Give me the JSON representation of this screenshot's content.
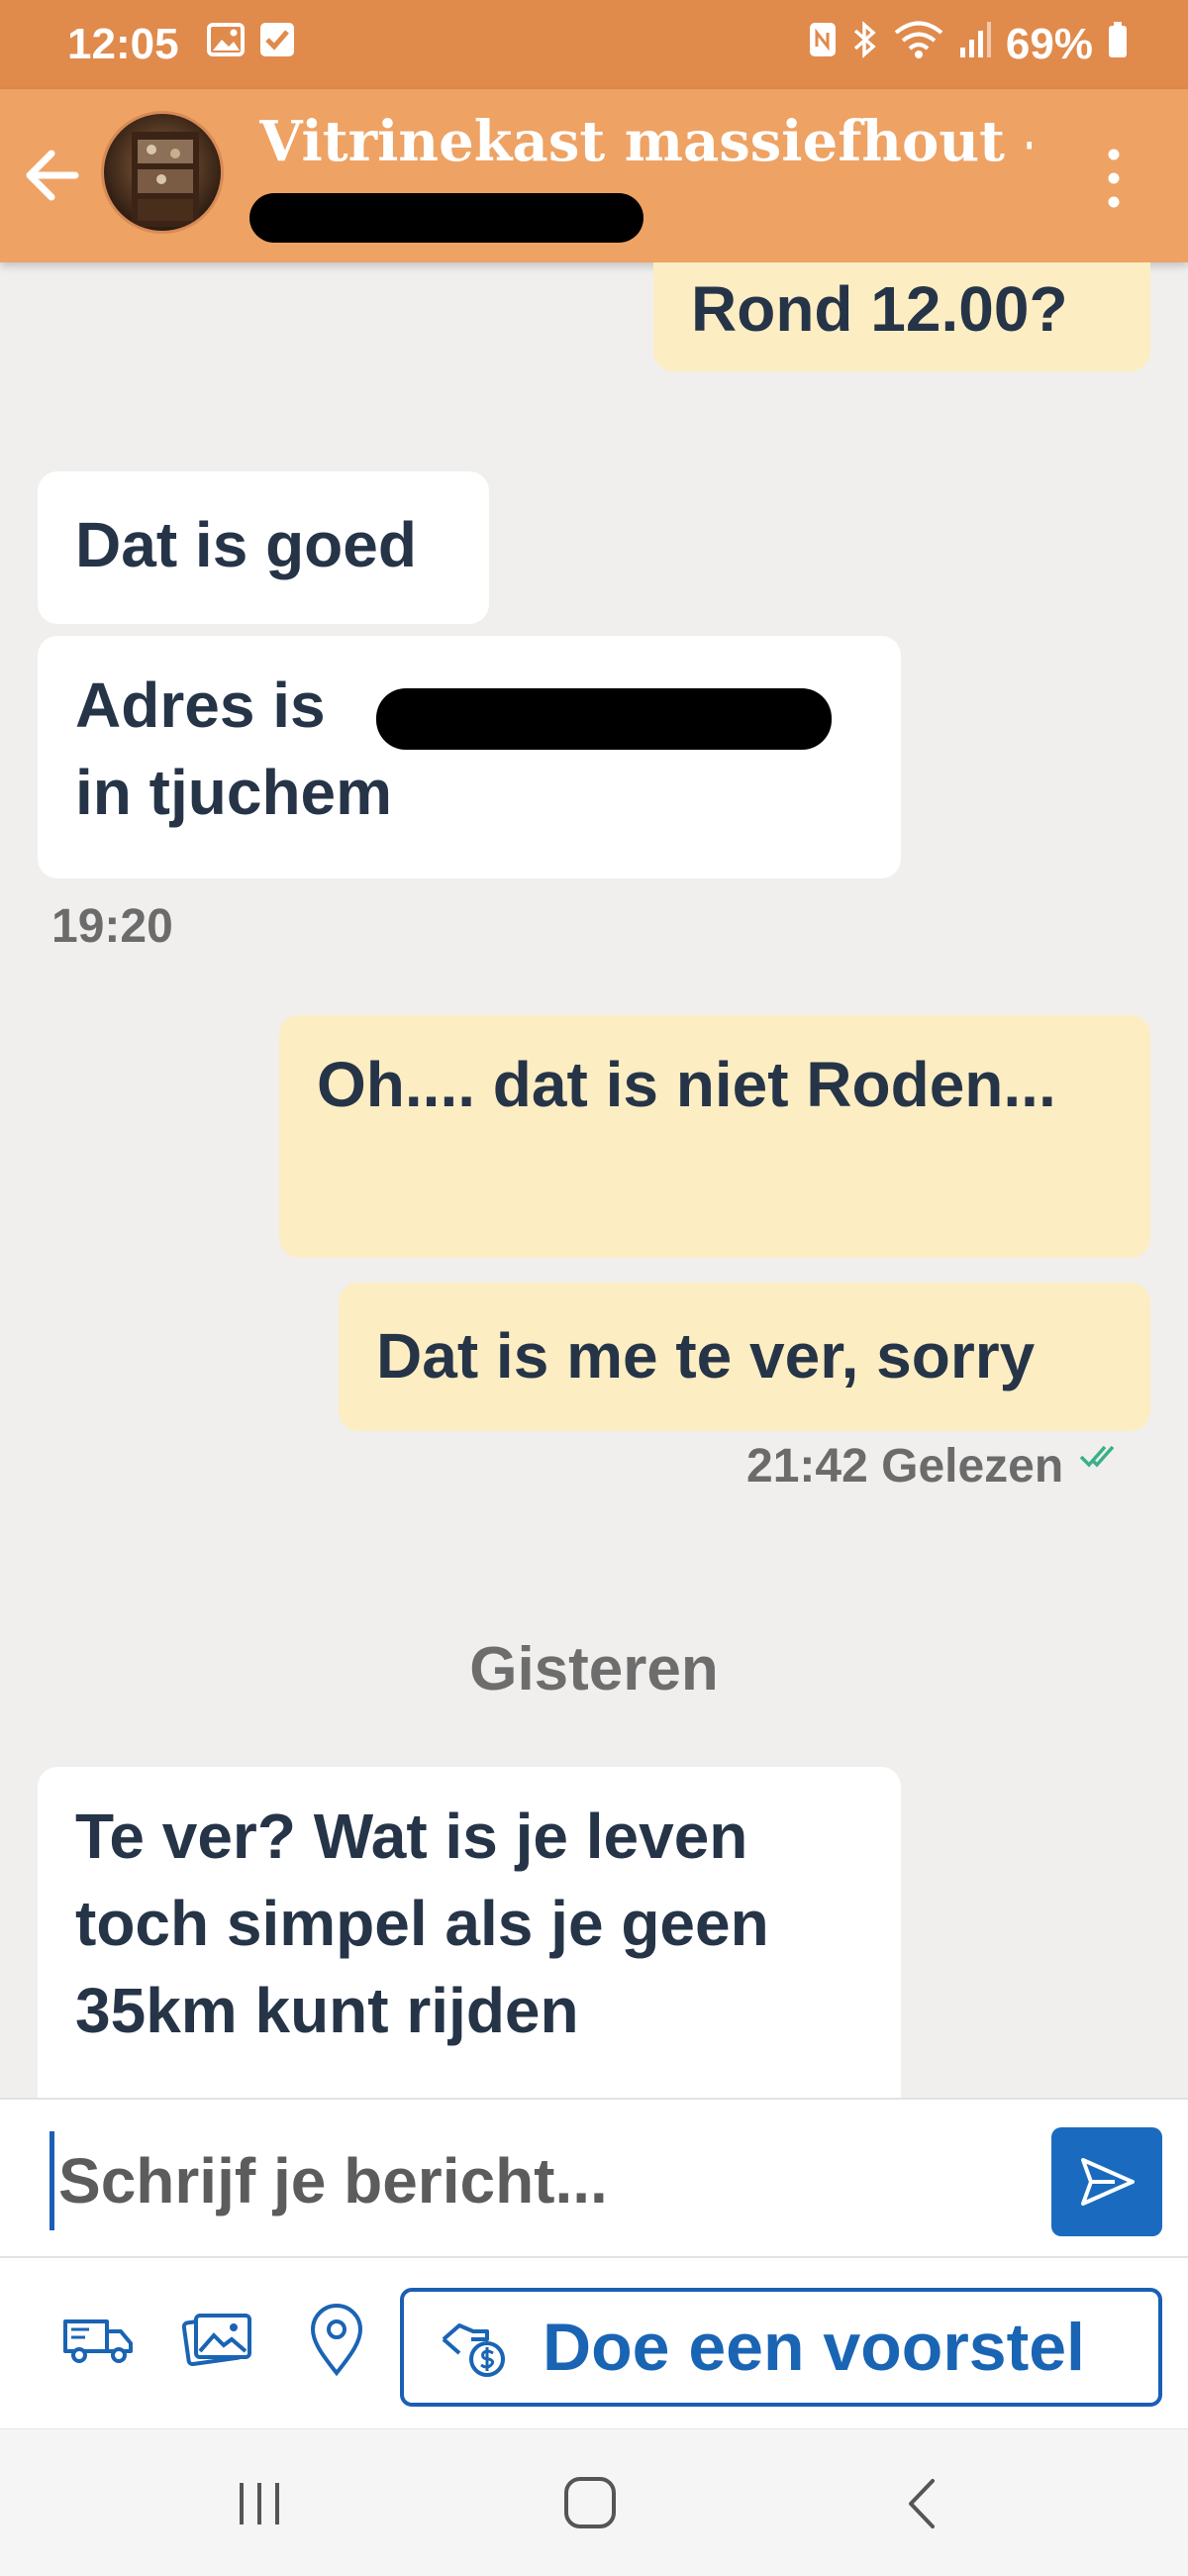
{
  "status_bar": {
    "time": "12:05",
    "battery": "69%"
  },
  "header": {
    "title": "Vitrinekast massiefhout -..."
  },
  "messages": [
    {
      "side": "out",
      "text": "Rond 12.00?"
    },
    {
      "side": "in",
      "text": "Dat is goed"
    },
    {
      "side": "in",
      "text_start": "Adres is",
      "text_end": "in tjuchem"
    },
    {
      "side": "in",
      "time": "19:20"
    },
    {
      "side": "out",
      "text": "Oh.... dat is niet Roden..."
    },
    {
      "side": "out",
      "text": "Dat is me te ver, sorry"
    },
    {
      "side": "out",
      "time": "21:42",
      "status": "Gelezen"
    },
    {
      "side": "in",
      "text": "Te ver? Wat is je leven toch simpel als je geen 35km kunt rijden"
    }
  ],
  "date_separator": "Gisteren",
  "composer": {
    "placeholder": "Schrijf je bericht..."
  },
  "toolbar": {
    "offer_label": "Doe een voorstel"
  },
  "colors": {
    "status_bar": "#e08a4c",
    "app_bar": "#eea264",
    "incoming_bubble": "#ffffff",
    "outgoing_bubble": "#fdedc2",
    "accent": "#1a6bc0",
    "read_check": "#3ab08a"
  },
  "icons": [
    "gallery-icon",
    "check-box-icon",
    "nfc-icon",
    "bluetooth-icon",
    "wifi-icon",
    "signal-icon",
    "battery-icon",
    "back-arrow-icon",
    "more-vert-icon",
    "double-check-icon",
    "send-icon",
    "truck-icon",
    "images-icon",
    "location-pin-icon",
    "hand-money-icon",
    "recent-apps-icon",
    "home-icon",
    "nav-back-icon"
  ]
}
